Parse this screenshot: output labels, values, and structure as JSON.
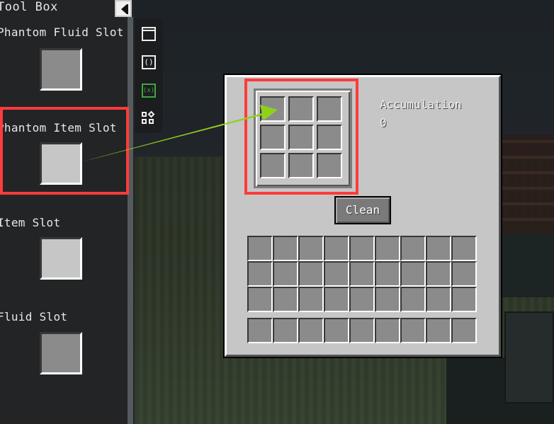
{
  "toolbox": {
    "title": "Tool Box",
    "items": [
      {
        "label": "Phantom Fluid Slot"
      },
      {
        "label": "Phantom Item Slot"
      },
      {
        "label": "Item Slot"
      },
      {
        "label": "Fluid Slot"
      }
    ]
  },
  "palette": {
    "icons": [
      "window-icon",
      "code-braces-icon",
      "variable-icon",
      "widgets-icon"
    ],
    "vars_glyph": "(x)",
    "braces_glyph": "()"
  },
  "gui": {
    "accumulation_label": "Accumulation",
    "accumulation_value": "0",
    "clean_label": "Clean",
    "crafting_grid": {
      "rows": 3,
      "cols": 3
    },
    "inventory": {
      "rows": 3,
      "cols": 9
    },
    "hotbar": {
      "cols": 9
    }
  },
  "colors": {
    "highlight": "#ff3b3b",
    "arrow": "#8fd11a"
  }
}
